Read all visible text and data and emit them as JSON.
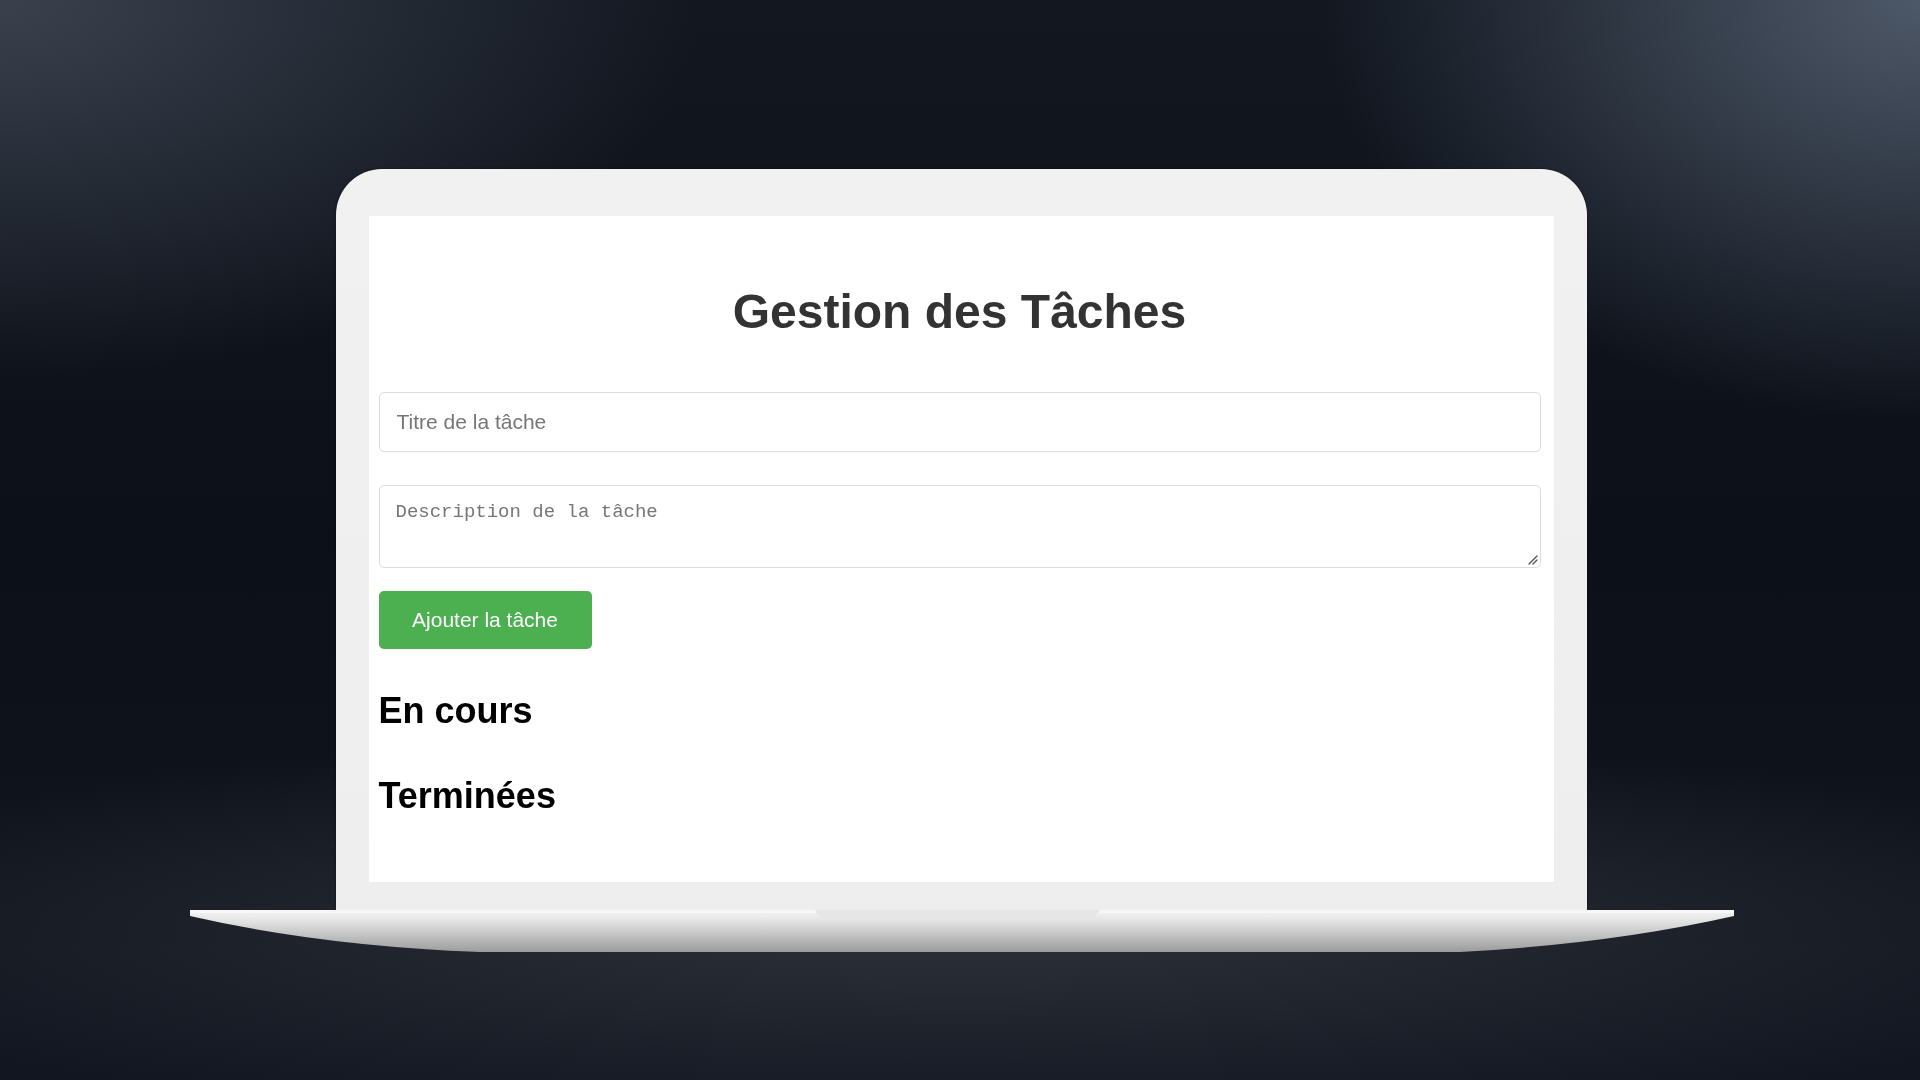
{
  "title": "Gestion des Tâches",
  "form": {
    "title_field": {
      "placeholder": "Titre de la tâche"
    },
    "description_field": {
      "placeholder": "Description de la tâche"
    },
    "submit_button": {
      "label": "Ajouter la tâche"
    }
  },
  "sections": [
    {
      "heading": "En cours"
    },
    {
      "heading": "Terminées"
    }
  ]
}
